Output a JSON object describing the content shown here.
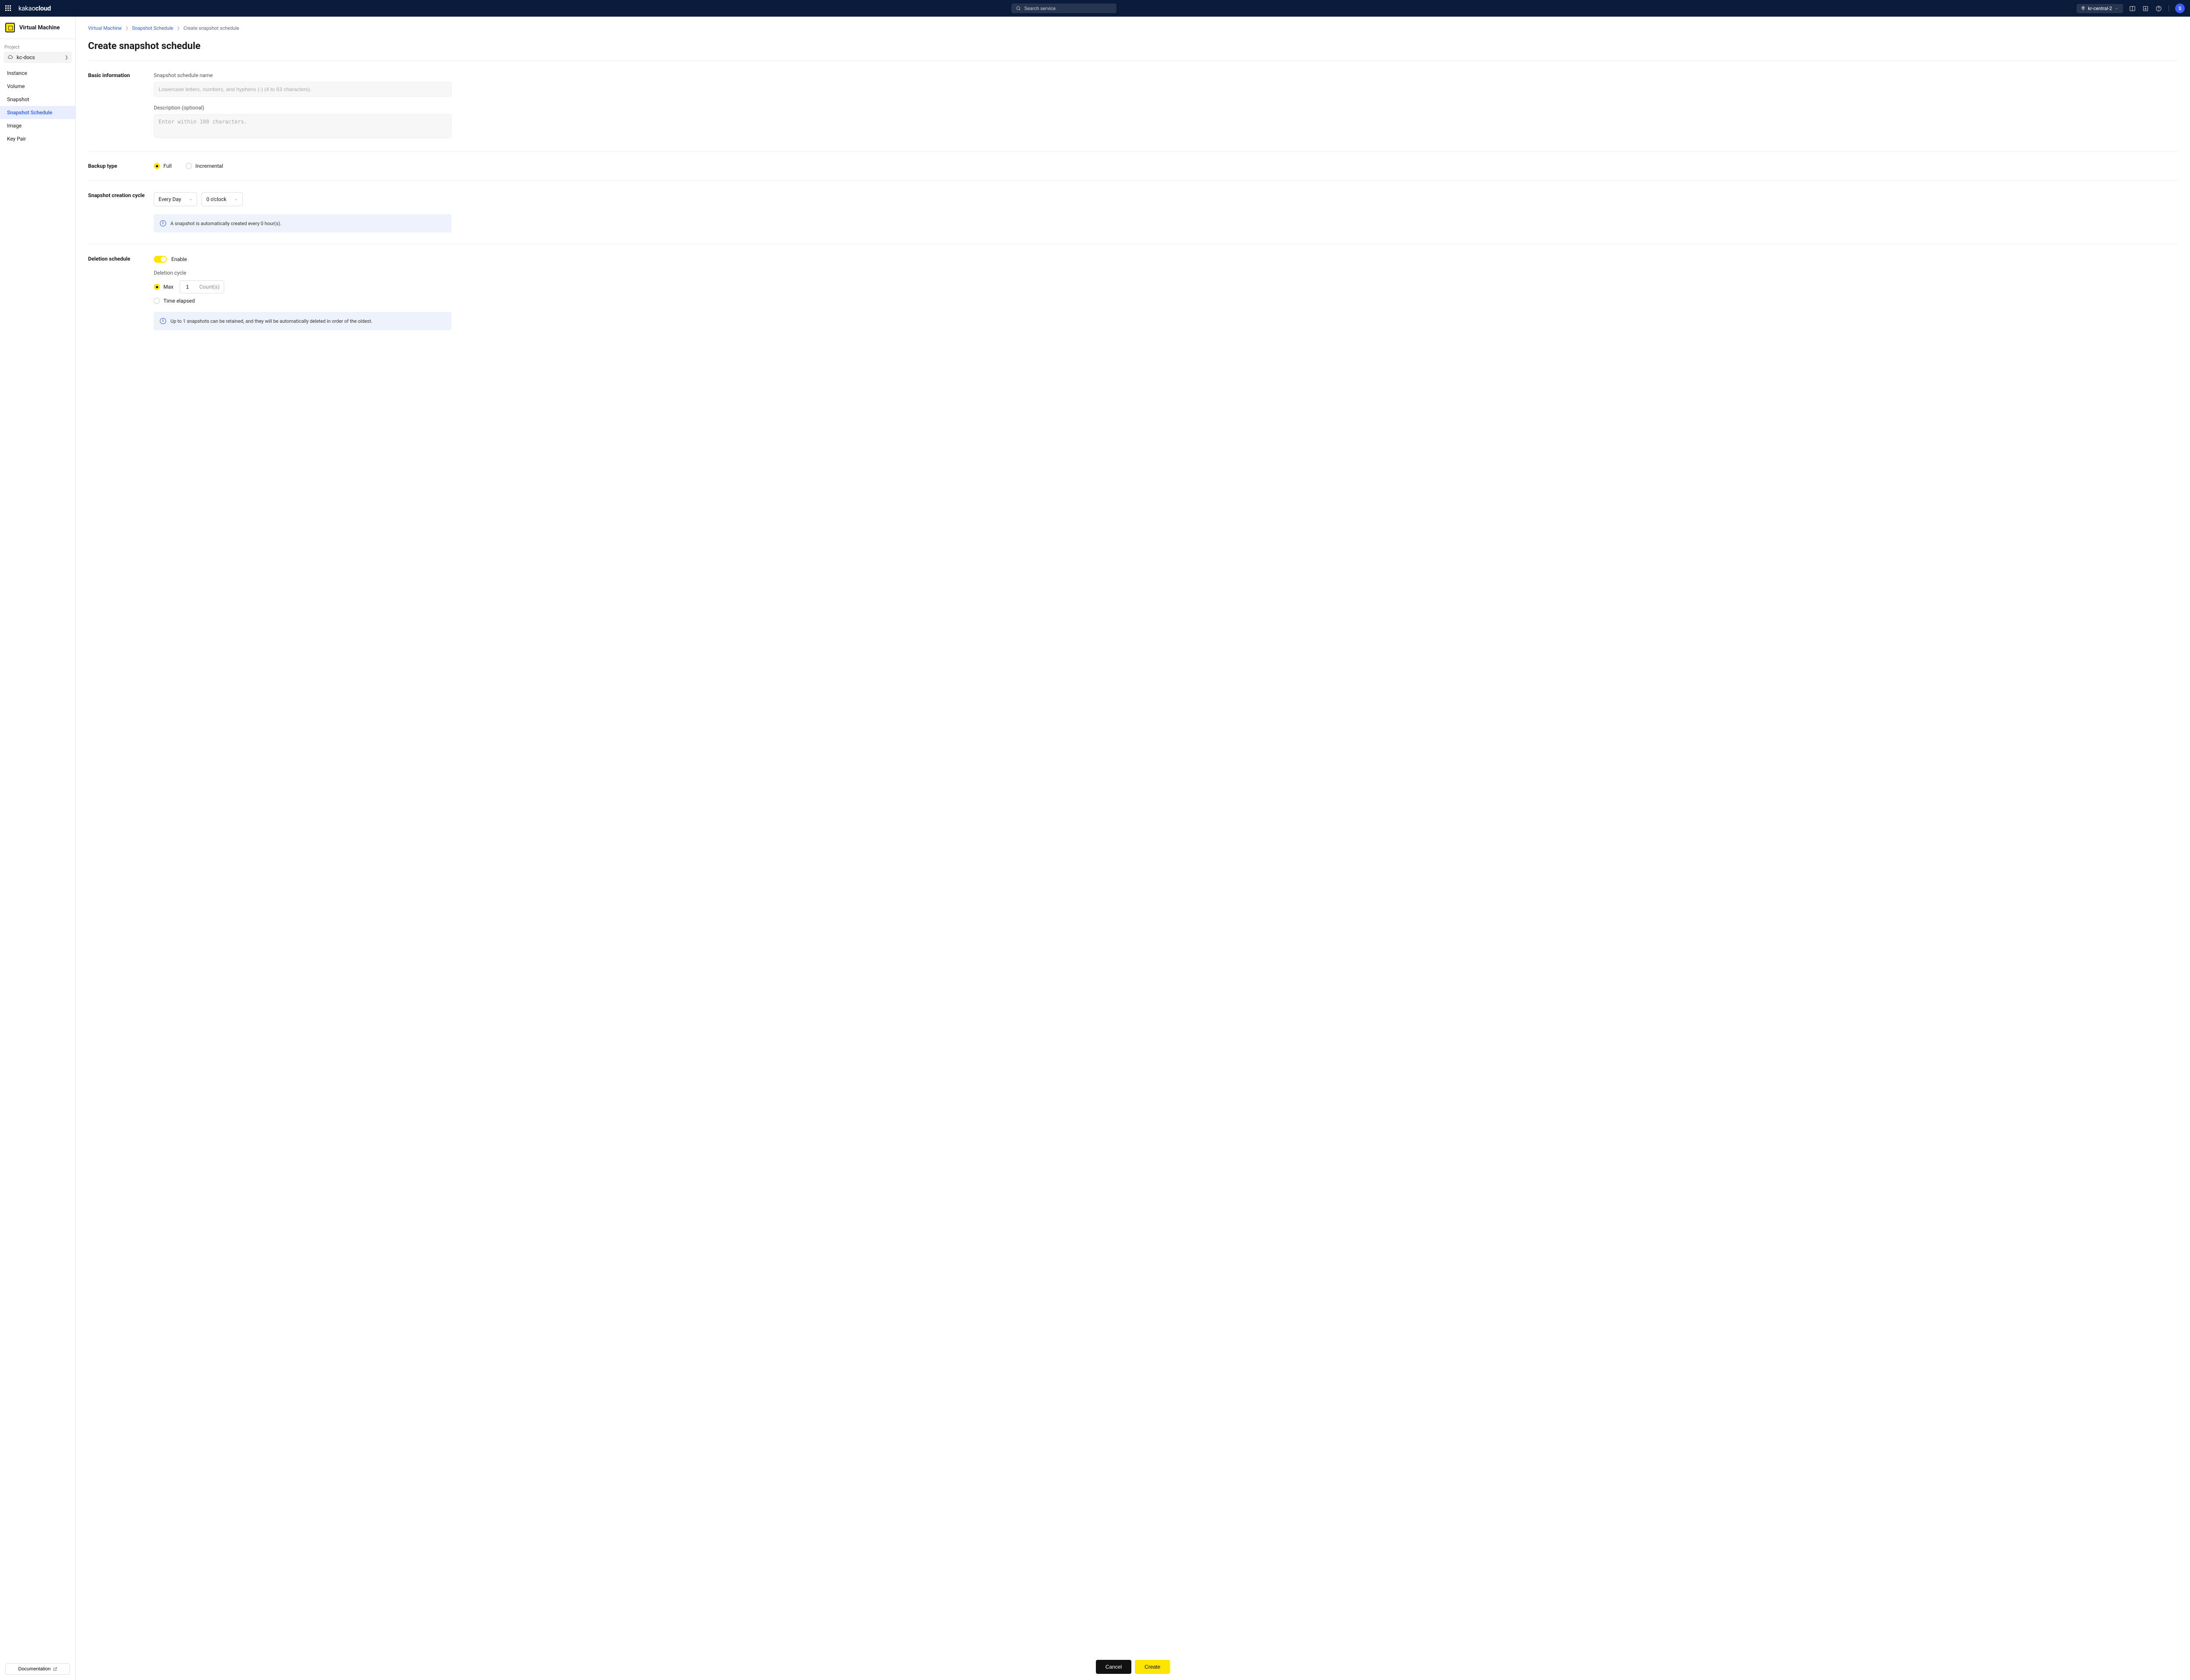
{
  "brand": {
    "prefix": "kakao",
    "suffix": "cloud"
  },
  "search": {
    "placeholder": "Search service"
  },
  "region": {
    "label": "kr-central-2"
  },
  "avatar": {
    "initial": "S"
  },
  "sidebar": {
    "title": "Virtual Machine",
    "projectLabel": "Project",
    "projectName": "kc-docs",
    "items": [
      "Instance",
      "Volume",
      "Snapshot",
      "Snapshot Schedule",
      "Image",
      "Key Pair"
    ],
    "activeIndex": 3,
    "docBtn": "Documentation"
  },
  "crumbs": {
    "a": "Virtual Machine",
    "b": "Snapshot Schedule",
    "c": "Create snapshot schedule"
  },
  "pageTitle": "Create snapshot schedule",
  "basic": {
    "section": "Basic information",
    "nameLabel": "Snapshot schedule name",
    "namePlaceholder": "Lowercase letters, numbers, and hyphens (-) (4 to 63 characters).",
    "descLabel": "Description (optional)",
    "descPlaceholder": "Enter within 100 characters."
  },
  "backup": {
    "section": "Backup type",
    "full": "Full",
    "incremental": "Incremental"
  },
  "cycle": {
    "section": "Snapshot creation cycle",
    "freq": "Every Day",
    "time": "0 o'clock",
    "info": "A snapshot is automatically created every 0 hour(s)."
  },
  "deletion": {
    "section": "Deletion schedule",
    "enable": "Enable",
    "cycleLabel": "Deletion cycle",
    "max": "Max",
    "countValue": "1",
    "countUnit": "Count(s)",
    "timeElapsed": "Time elapsed",
    "info": "Up to 1 snapshots can be retained, and they will be automatically deleted in order of the oldest."
  },
  "footer": {
    "cancel": "Cancel",
    "create": "Create"
  }
}
